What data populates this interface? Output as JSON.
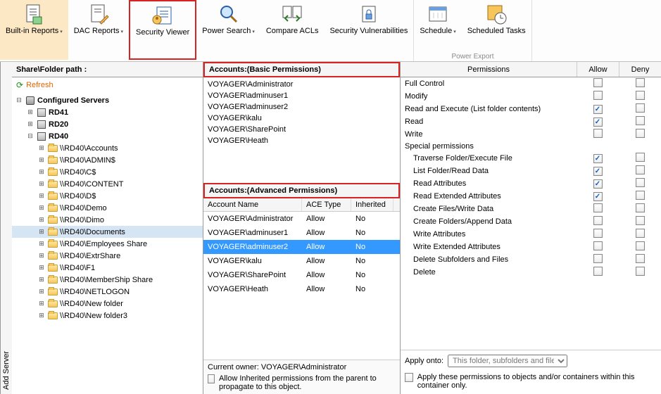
{
  "ribbon": {
    "group1_caption": "",
    "group2_caption": "Power Export",
    "buttons": {
      "builtin": "Built-in\nReports",
      "dac": "DAC\nReports",
      "secviewer": "Security\nViewer",
      "powersearch": "Power\nSearch",
      "compareacl": "Compare\nACLs",
      "secvuln": "Security\nVulnerabilities",
      "schedule": "Schedule",
      "schedtasks": "Scheduled\nTasks"
    }
  },
  "sidetab": "Add Server",
  "tree": {
    "header": "Share\\Folder path :",
    "refresh": "Refresh",
    "root_label": "Configured Servers",
    "servers": [
      {
        "name": "RD41",
        "expanded": false
      },
      {
        "name": "RD20",
        "expanded": false
      },
      {
        "name": "RD40",
        "expanded": true,
        "children": [
          "\\\\RD40\\Accounts",
          "\\\\RD40\\ADMIN$",
          "\\\\RD40\\C$",
          "\\\\RD40\\CONTENT",
          "\\\\RD40\\D$",
          "\\\\RD40\\Demo",
          "\\\\RD40\\Dimo",
          "\\\\RD40\\Documents",
          "\\\\RD40\\Employees Share",
          "\\\\RD40\\ExtrShare",
          "\\\\RD40\\F1",
          "\\\\RD40\\MemberShip Share",
          "\\\\RD40\\NETLOGON",
          "\\\\RD40\\New folder",
          "\\\\RD40\\New folder3"
        ],
        "selected_index": 7
      }
    ]
  },
  "accounts_basic": {
    "header": "Accounts:(Basic Permissions)",
    "items": [
      "VOYAGER\\Administrator",
      "VOYAGER\\adminuser1",
      "VOYAGER\\adminuser2",
      "VOYAGER\\kalu",
      "VOYAGER\\SharePoint",
      "VOYAGER\\Heath"
    ]
  },
  "accounts_adv": {
    "header": "Accounts:(Advanced Permissions)",
    "columns": {
      "name": "Account Name",
      "ace": "ACE Type",
      "inh": "Inherited"
    },
    "rows": [
      {
        "name": "VOYAGER\\Administrator",
        "ace": "Allow",
        "inh": "No"
      },
      {
        "name": "VOYAGER\\adminuser1",
        "ace": "Allow",
        "inh": "No"
      },
      {
        "name": "VOYAGER\\adminuser2",
        "ace": "Allow",
        "inh": "No"
      },
      {
        "name": "VOYAGER\\kalu",
        "ace": "Allow",
        "inh": "No"
      },
      {
        "name": "VOYAGER\\SharePoint",
        "ace": "Allow",
        "inh": "No"
      },
      {
        "name": "VOYAGER\\Heath",
        "ace": "Allow",
        "inh": "No"
      }
    ],
    "selected_index": 2
  },
  "owner": {
    "label": "Current owner:",
    "value": "VOYAGER\\Administrator",
    "inherit_label": "Allow Inherited permissions from the parent to propagate to this object."
  },
  "permissions": {
    "head_name": "Permissions",
    "head_allow": "Allow",
    "head_deny": "Deny",
    "rows": [
      {
        "label": "Full Control",
        "allow": false,
        "deny": false
      },
      {
        "label": "Modify",
        "allow": false,
        "deny": false
      },
      {
        "label": "Read and Execute (List folder contents)",
        "allow": true,
        "deny": false
      },
      {
        "label": "Read",
        "allow": true,
        "deny": false
      },
      {
        "label": "Write",
        "allow": false,
        "deny": false
      },
      {
        "label": "Special permissions",
        "category": true
      },
      {
        "label": "Traverse Folder/Execute File",
        "indent": true,
        "allow": true,
        "deny": false
      },
      {
        "label": "List Folder/Read Data",
        "indent": true,
        "allow": true,
        "deny": false
      },
      {
        "label": "Read Attributes",
        "indent": true,
        "allow": true,
        "deny": false
      },
      {
        "label": "Read Extended Attributes",
        "indent": true,
        "allow": true,
        "deny": false
      },
      {
        "label": "Create Files/Write Data",
        "indent": true,
        "allow": false,
        "deny": false
      },
      {
        "label": "Create Folders/Append Data",
        "indent": true,
        "allow": false,
        "deny": false
      },
      {
        "label": "Write Attributes",
        "indent": true,
        "allow": false,
        "deny": false
      },
      {
        "label": "Write Extended Attributes",
        "indent": true,
        "allow": false,
        "deny": false
      },
      {
        "label": "Delete Subfolders and Files",
        "indent": true,
        "allow": false,
        "deny": false
      },
      {
        "label": "Delete",
        "indent": true,
        "allow": false,
        "deny": false
      }
    ],
    "apply_label": "Apply onto:",
    "apply_value": "This folder, subfolders and file",
    "apply_chk_label": "Apply these permissions to objects and/or containers within this container only."
  }
}
